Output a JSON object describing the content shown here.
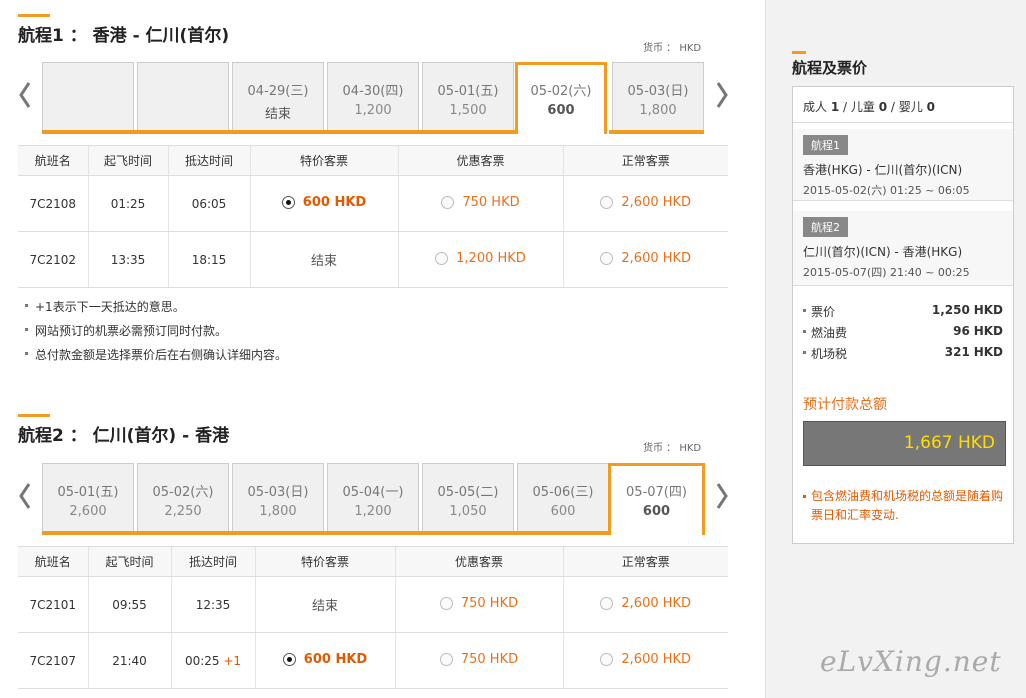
{
  "leg1": {
    "title": "航程1 ： 香港 - 仁川(首尔)",
    "currency": "货币 ： HKD",
    "days": [
      {
        "date": "",
        "price": ""
      },
      {
        "date": "",
        "price": ""
      },
      {
        "date": "04-29(三)",
        "price": "结束"
      },
      {
        "date": "04-30(四)",
        "price": "1,200"
      },
      {
        "date": "05-01(五)",
        "price": "1,500"
      },
      {
        "date": "05-02(六)",
        "price": "600"
      },
      {
        "date": "05-03(日)",
        "price": "1,800"
      }
    ],
    "headers": [
      "航班名",
      "起飞时间",
      "抵达时间",
      "特价客票",
      "优惠客票",
      "正常客票"
    ],
    "rows": [
      {
        "flight": "7C2108",
        "dep": "01:25",
        "arr": "06:05",
        "arr_plus": "",
        "special": "600 HKD",
        "promo": "750 HKD",
        "normal": "2,600 HKD"
      },
      {
        "flight": "7C2102",
        "dep": "13:35",
        "arr": "18:15",
        "arr_plus": "",
        "special": "结束",
        "promo": "1,200 HKD",
        "normal": "2,600 HKD"
      }
    ],
    "notes": [
      "+1表示下一天抵达的意思。",
      "网站预订的机票必需预订同时付款。",
      "总付款金额是选择票价后在右侧确认详细内容。"
    ]
  },
  "leg2": {
    "title": "航程2 ： 仁川(首尔) - 香港",
    "currency": "货币 ： HKD",
    "days": [
      {
        "date": "05-01(五)",
        "price": "2,600"
      },
      {
        "date": "05-02(六)",
        "price": "2,250"
      },
      {
        "date": "05-03(日)",
        "price": "1,800"
      },
      {
        "date": "05-04(一)",
        "price": "1,200"
      },
      {
        "date": "05-05(二)",
        "price": "1,050"
      },
      {
        "date": "05-06(三)",
        "price": "600"
      },
      {
        "date": "05-07(四)",
        "price": "600"
      }
    ],
    "headers": [
      "航班名",
      "起飞时间",
      "抵达时间",
      "特价客票",
      "优惠客票",
      "正常客票"
    ],
    "rows": [
      {
        "flight": "7C2101",
        "dep": "09:55",
        "arr": "12:35",
        "arr_plus": "",
        "special": "结束",
        "promo": "750 HKD",
        "normal": "2,600 HKD"
      },
      {
        "flight": "7C2107",
        "dep": "21:40",
        "arr": "00:25",
        "arr_plus": "+1",
        "special": "600 HKD",
        "promo": "750 HKD",
        "normal": "2,600 HKD"
      }
    ]
  },
  "summary": {
    "title": "航程及票价",
    "pax_adult_label": "成人",
    "pax_adult": "1",
    "pax_child_label": "儿童",
    "pax_child": "0",
    "pax_infant_label": "婴儿",
    "pax_infant": "0",
    "leg1_badge": "航程1",
    "leg1_route": "香港(HKG) - 仁川(首尔)(ICN)",
    "leg1_time": "2015-05-02(六) 01:25 ~ 06:05",
    "leg2_badge": "航程2",
    "leg2_route": "仁川(首尔)(ICN) - 香港(HKG)",
    "leg2_time": "2015-05-07(四) 21:40 ~ 00:25",
    "fare_label": "票价",
    "fare_value": "1,250",
    "fuel_label": "燃油费",
    "fuel_value": "96",
    "tax_label": "机场税",
    "tax_value": "321",
    "unit": "HKD",
    "total_label": "预计付款总额",
    "total_value": "1,667 HKD",
    "total_note": "包含燃油费和机场税的总额是随着购票日和汇率变动."
  },
  "watermark": "eLvXing.net",
  "colors": {
    "accent": "#f29c1f",
    "price": "#e8701a",
    "total_text": "#ffdd00"
  }
}
